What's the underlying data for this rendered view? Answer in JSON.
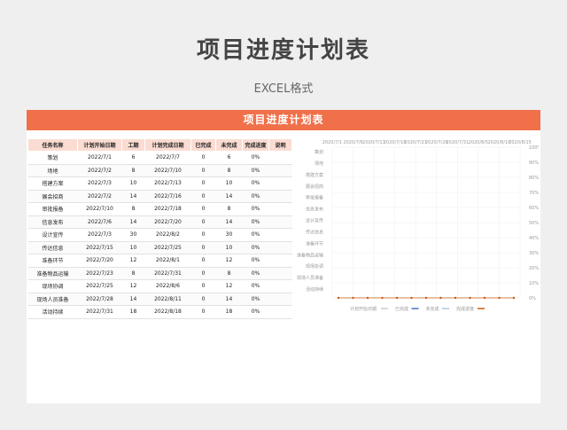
{
  "page": {
    "title": "项目进度计划表",
    "subtitle": "EXCEL格式"
  },
  "sheet": {
    "header": "项目进度计划表",
    "columns": [
      "任务名称",
      "计划开始日期",
      "工期",
      "计划完成日期",
      "已完成",
      "未完成",
      "完成进度",
      "说明"
    ],
    "rows": [
      [
        "策划",
        "2022/7/1",
        "6",
        "2022/7/7",
        "0",
        "6",
        "0%",
        ""
      ],
      [
        "场地",
        "2022/7/2",
        "8",
        "2022/7/10",
        "0",
        "8",
        "0%",
        ""
      ],
      [
        "搭建方案",
        "2022/7/3",
        "10",
        "2022/7/13",
        "0",
        "10",
        "0%",
        ""
      ],
      [
        "展会招商",
        "2022/7/2",
        "14",
        "2022/7/16",
        "0",
        "14",
        "0%",
        ""
      ],
      [
        "审批报备",
        "2022/7/10",
        "8",
        "2022/7/18",
        "0",
        "8",
        "0%",
        ""
      ],
      [
        "信息发布",
        "2022/7/6",
        "14",
        "2022/7/20",
        "0",
        "14",
        "0%",
        ""
      ],
      [
        "设计宣传",
        "2022/7/3",
        "30",
        "2022/8/2",
        "0",
        "30",
        "0%",
        ""
      ],
      [
        "传达信息",
        "2022/7/15",
        "10",
        "2022/7/25",
        "0",
        "10",
        "0%",
        ""
      ],
      [
        "准备环节",
        "2022/7/20",
        "12",
        "2022/8/1",
        "0",
        "12",
        "0%",
        ""
      ],
      [
        "准备物品运输",
        "2022/7/23",
        "8",
        "2022/7/31",
        "0",
        "8",
        "0%",
        ""
      ],
      [
        "现场协调",
        "2022/7/25",
        "12",
        "2022/8/6",
        "0",
        "12",
        "0%",
        ""
      ],
      [
        "现场人员准备",
        "2022/7/28",
        "14",
        "2022/8/11",
        "0",
        "14",
        "0%",
        ""
      ],
      [
        "活动持续",
        "2022/7/31",
        "18",
        "2022/8/18",
        "0",
        "18",
        "0%",
        ""
      ]
    ]
  },
  "chart_data": {
    "type": "bar",
    "orientation": "horizontal-stacked",
    "x_ticks": [
      "2020/7/1",
      "2020/7/6",
      "2020/7/11",
      "2020/7/16",
      "2020/7/21",
      "2020/7/26",
      "2020/7/31",
      "2020/8/5",
      "2020/8/10",
      "2020/8/15"
    ],
    "categories": [
      "策划",
      "场地",
      "搭建方案",
      "展会招商",
      "审批报备",
      "信息发布",
      "设计宣传",
      "传达信息",
      "准备环节",
      "准备物品运输",
      "现场协调",
      "现场人员准备",
      "活动持续"
    ],
    "y2_ticks": [
      "100%",
      "90%",
      "80%",
      "70%",
      "60%",
      "50%",
      "40%",
      "30%",
      "20%",
      "10%",
      "0%"
    ],
    "series": [
      {
        "name": "计划开始日期",
        "values": [
          "2022/7/1",
          "2022/7/2",
          "2022/7/3",
          "2022/7/2",
          "2022/7/10",
          "2022/7/6",
          "2022/7/3",
          "2022/7/15",
          "2022/7/20",
          "2022/7/23",
          "2022/7/25",
          "2022/7/28",
          "2022/7/31"
        ]
      },
      {
        "name": "已完成",
        "values": [
          0,
          0,
          0,
          0,
          0,
          0,
          0,
          0,
          0,
          0,
          0,
          0,
          0
        ]
      },
      {
        "name": "未完成",
        "values": [
          6,
          8,
          10,
          14,
          8,
          14,
          30,
          10,
          12,
          8,
          12,
          14,
          18
        ]
      },
      {
        "name": "完成进度",
        "values": [
          0,
          0,
          0,
          0,
          0,
          0,
          0,
          0,
          0,
          0,
          0,
          0,
          0
        ]
      }
    ],
    "legend_colors": {
      "计划开始日期": "#cccccc",
      "已完成": "#4472c4",
      "未完成": "#b4c6e7",
      "完成进度": "#c55a11"
    },
    "grid": true,
    "legend_position": "bottom"
  }
}
